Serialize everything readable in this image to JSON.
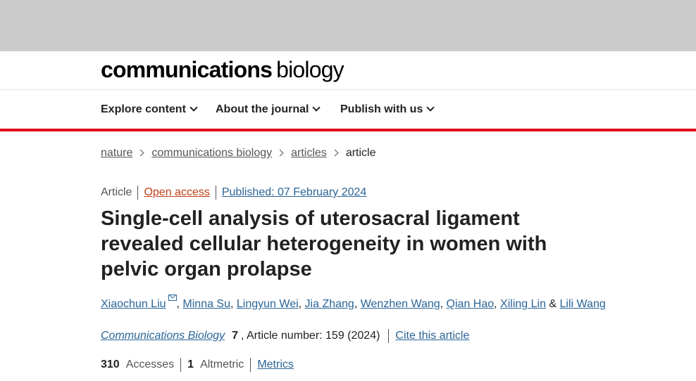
{
  "header": {
    "logo_bold": "communications",
    "logo_light": "biology"
  },
  "nav": {
    "items": [
      {
        "label": "Explore content"
      },
      {
        "label": "About the journal"
      },
      {
        "label": "Publish with us"
      }
    ]
  },
  "breadcrumb": {
    "items": [
      "nature",
      "communications biology",
      "articles"
    ],
    "current": "article"
  },
  "article": {
    "type": "Article",
    "access": "Open access",
    "published": "Published: 07 February 2024",
    "title": "Single-cell analysis of uterosacral ligament revealed cellular heterogeneity in women with pelvic organ prolapse",
    "authors": [
      "Xiaochun Liu",
      "Minna Su",
      "Lingyun Wei",
      "Jia Zhang",
      "Wenzhen Wang",
      "Qian Hao",
      "Xiling Lin",
      "Lili Wang"
    ],
    "author_sep": ", ",
    "author_last_sep": " & ",
    "corresponding_icon": "mail-icon",
    "journal": "Communications Biology",
    "volume": "7",
    "article_number": ", Article number: 159 (2024)",
    "cite_link": "Cite this article"
  },
  "metrics": {
    "accesses_count": "310",
    "accesses_label": "Accesses",
    "altmetric_count": "1",
    "altmetric_label": "Altmetric",
    "metrics_link": "Metrics"
  },
  "colors": {
    "accent_red": "#e0001a",
    "link_blue": "#2a6496",
    "open_access": "#c0401a",
    "top_bar": "#cccccc"
  }
}
